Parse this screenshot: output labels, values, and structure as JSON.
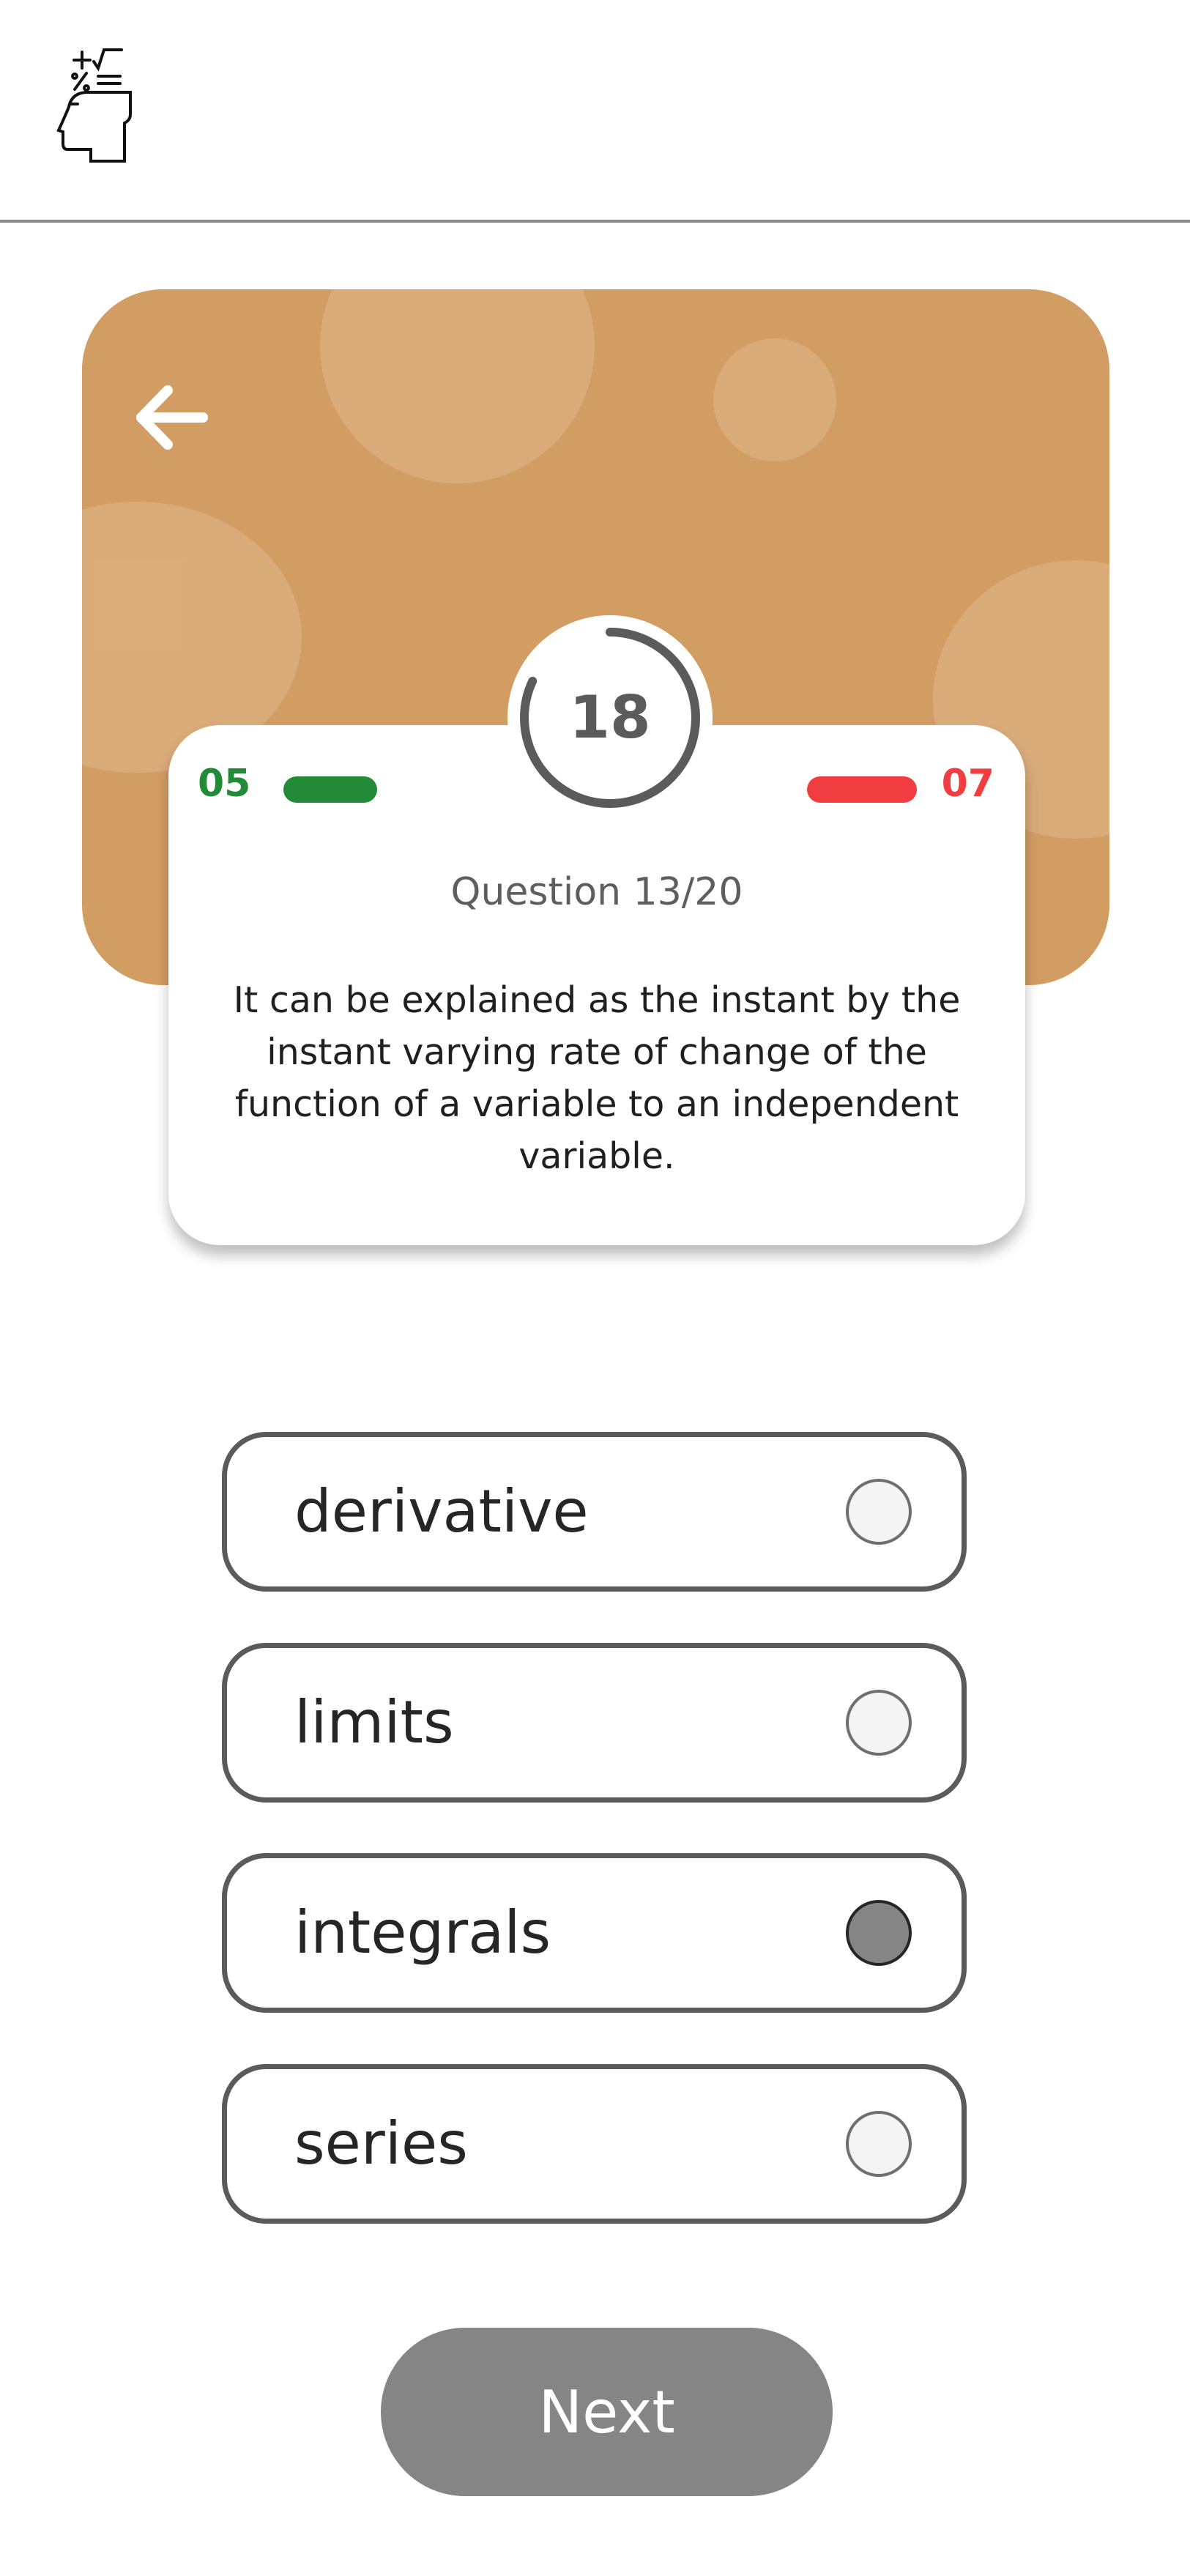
{
  "score": {
    "correct": "05",
    "wrong": "07",
    "correct_color": "#238a37",
    "wrong_color": "#f13d3f"
  },
  "timer": {
    "value": "18",
    "progress": 0.82
  },
  "question": {
    "counter": "Question 13/20",
    "text": "It can be explained as the instant by the instant varying rate of change of the function of a variable to an independent variable."
  },
  "options": [
    {
      "label": "derivative",
      "selected": false
    },
    {
      "label": "limits",
      "selected": false
    },
    {
      "label": "integrals",
      "selected": true
    },
    {
      "label": "series",
      "selected": false
    }
  ],
  "next_label": "Next",
  "icons": {
    "logo": "head-math-icon",
    "back": "arrow-left-icon"
  },
  "colors": {
    "hero": "#d29d62",
    "button": "#858585"
  }
}
